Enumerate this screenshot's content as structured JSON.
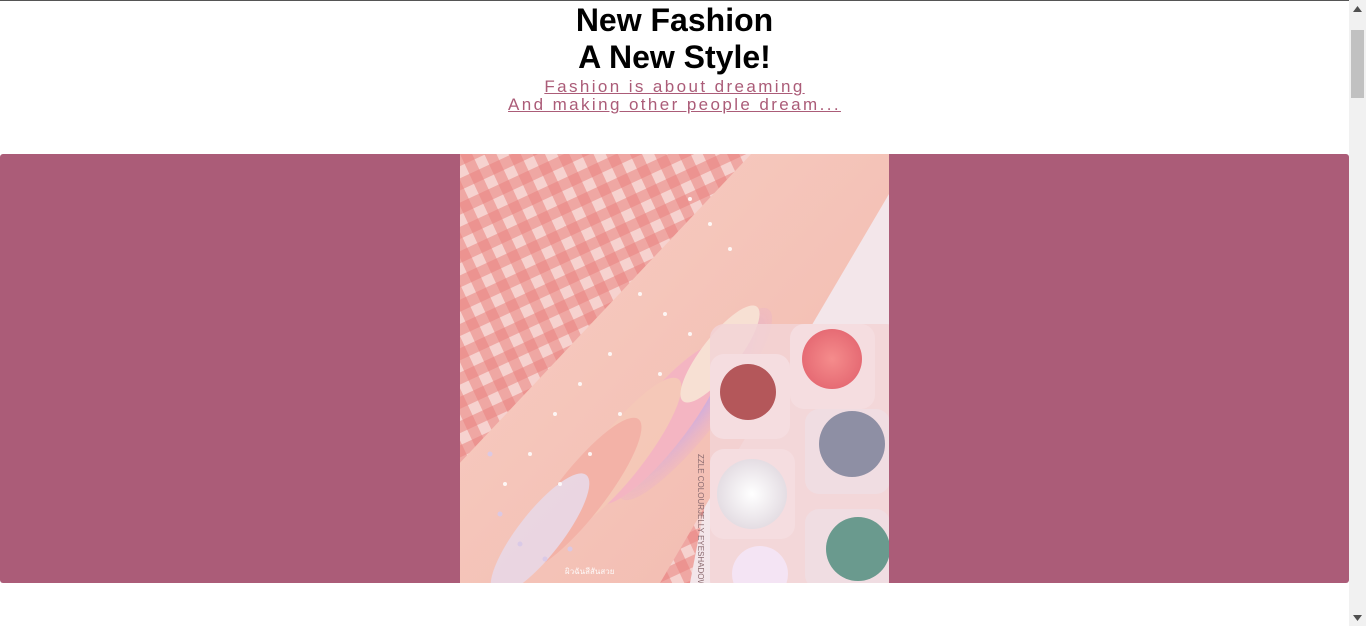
{
  "header": {
    "title_line1": "New Fashion",
    "title_line2": "A New Style!",
    "tagline_line1": "Fashion is about dreaming",
    "tagline_line2": "And making other people dream..."
  },
  "banner": {
    "image_icon": "glitter-swatch-photo-icon",
    "watermark": "ผิวฉันสีสันสวย"
  },
  "colors": {
    "accent": "#ab5c78",
    "title": "#000000",
    "background": "#ffffff"
  },
  "scrollbar": {
    "up_icon": "scroll-up-arrow-icon",
    "down_icon": "scroll-down-arrow-icon"
  }
}
